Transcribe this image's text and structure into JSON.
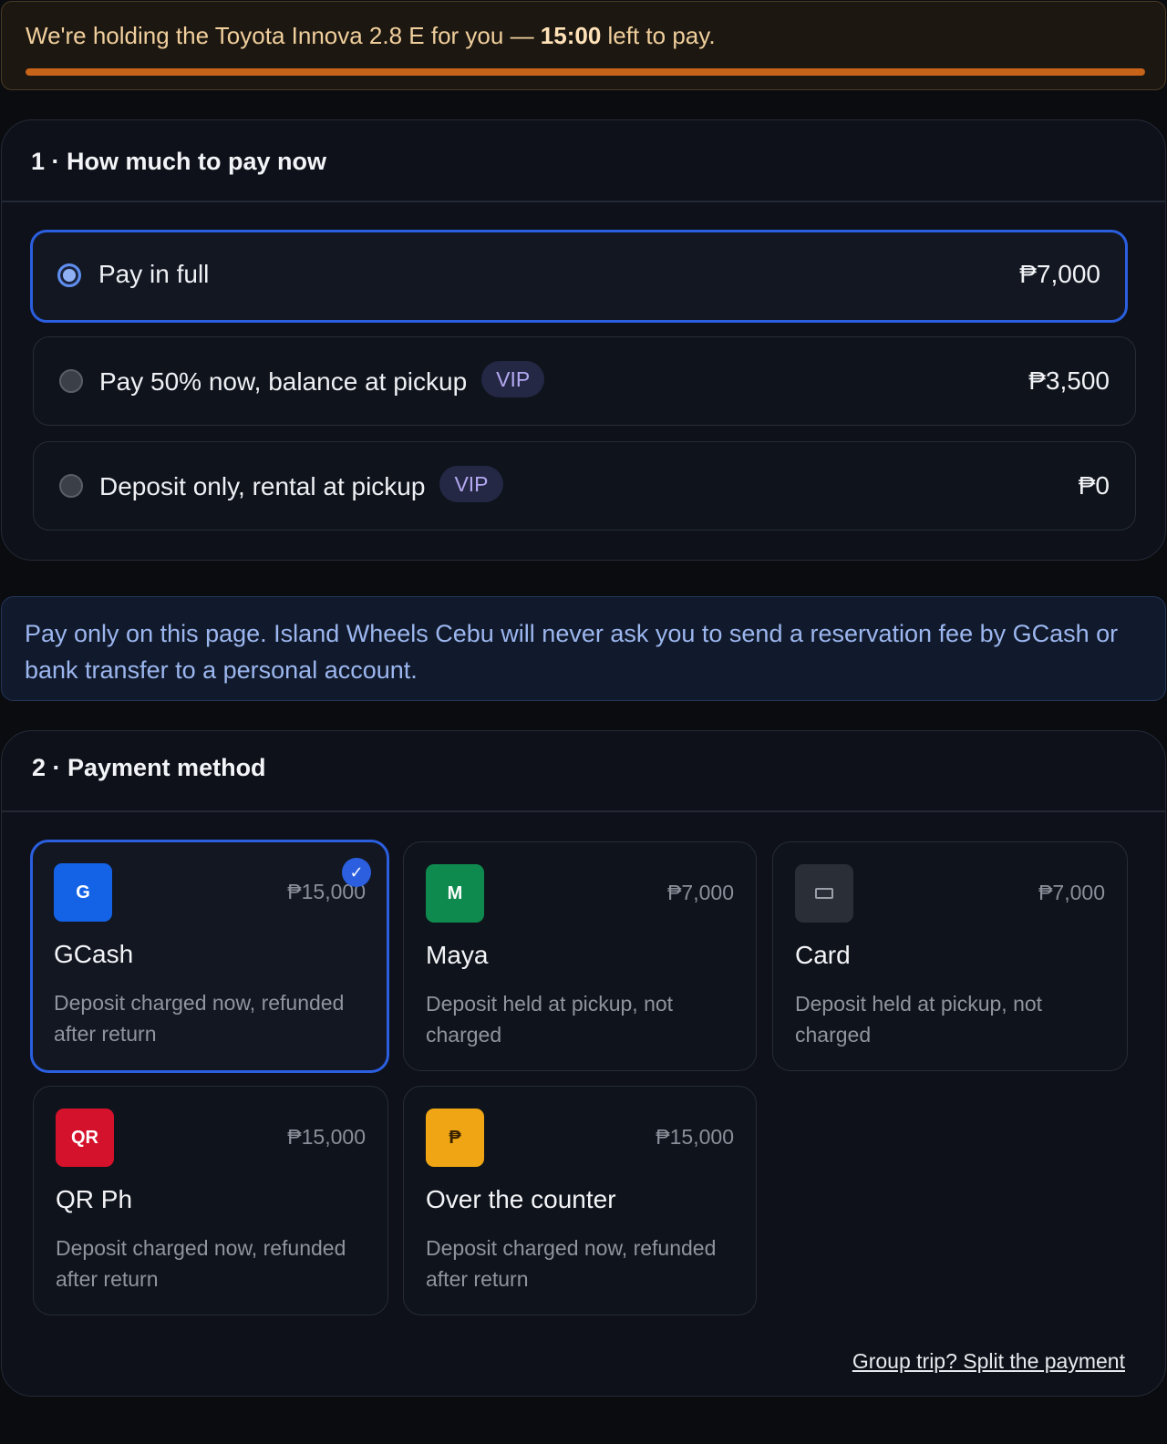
{
  "hold_banner": {
    "text_before": "We're holding the Toyota Innova 2.8 E for you — ",
    "timer": "15:00",
    "text_after": " left to pay.",
    "progress_fraction": 1.0,
    "accent_color": "#c7641a"
  },
  "pay_amount": {
    "title": "1 · How much to pay now",
    "options": [
      {
        "label": "Pay in full",
        "badge": "",
        "price": "₱7,000",
        "selected": true
      },
      {
        "label": "Pay 50% now, balance at pickup",
        "badge": "VIP",
        "price": "₱3,500",
        "selected": false
      },
      {
        "label": "Deposit only, rental at pickup",
        "badge": "VIP",
        "price": "₱0",
        "selected": false
      }
    ]
  },
  "notice": {
    "text": "Pay only on this page. Island Wheels Cebu will never ask you to send a reservation fee by GCash or bank transfer to a personal account."
  },
  "payment_method": {
    "title": "2 · Payment method",
    "methods": [
      {
        "icon_letter": "G",
        "icon_name": "gcash-icon",
        "icon_color": "#1463e6",
        "amount": "₱15,000",
        "name": "GCash",
        "description": "Deposit charged now, refunded after return",
        "selected": true,
        "check": "✓"
      },
      {
        "icon_letter": "M",
        "icon_name": "maya-icon",
        "icon_color": "#0f8a4f",
        "amount": "₱7,000",
        "name": "Maya",
        "description": "Deposit held at pickup, not charged",
        "selected": false
      },
      {
        "icon_letter": "",
        "icon_name": "credit-card-icon",
        "icon_color": "#2a2e37",
        "amount": "₱7,000",
        "name": "Card",
        "description": "Deposit held at pickup, not charged",
        "selected": false
      },
      {
        "icon_letter": "QR",
        "icon_name": "qr-ph-icon",
        "icon_color": "#d4122c",
        "amount": "₱15,000",
        "name": "QR Ph",
        "description": "Deposit charged now, refunded after return",
        "selected": false
      },
      {
        "icon_letter": "₱",
        "icon_name": "peso-icon",
        "icon_color": "#f0a614",
        "amount": "₱15,000",
        "name": "Over the counter",
        "description": "Deposit charged now, refunded after return",
        "selected": false
      }
    ],
    "split_link": "Group trip? Split the payment"
  }
}
